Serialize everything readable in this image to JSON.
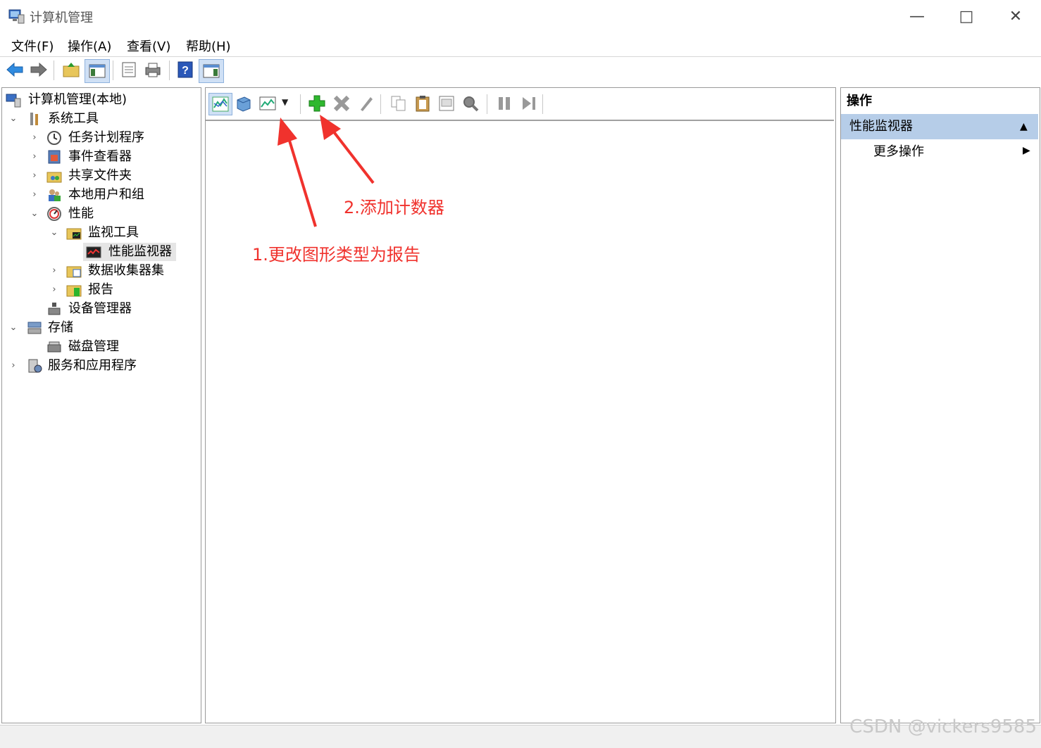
{
  "window": {
    "title": "计算机管理"
  },
  "menu": [
    "文件(F)",
    "操作(A)",
    "查看(V)",
    "帮助(H)"
  ],
  "tree": {
    "root": "计算机管理(本地)",
    "system_tools": "系统工具",
    "task_scheduler": "任务计划程序",
    "event_viewer": "事件查看器",
    "shared_folders": "共享文件夹",
    "local_users": "本地用户和组",
    "performance": "性能",
    "monitor_tools": "监视工具",
    "perf_monitor": "性能监视器",
    "data_collector_sets": "数据收集器集",
    "reports": "报告",
    "device_manager": "设备管理器",
    "storage": "存储",
    "disk_management": "磁盘管理",
    "services_apps": "服务和应用程序"
  },
  "actions": {
    "header": "操作",
    "section": "性能监视器",
    "more": "更多操作"
  },
  "annotations": {
    "step1": "1.更改图形类型为报告",
    "step2": "2.添加计数器"
  },
  "watermark": "CSDN @vickers9585",
  "colors": {
    "selection": "#b6cde8",
    "annotation": "#f0322d",
    "accent": "#1e6fd9"
  }
}
